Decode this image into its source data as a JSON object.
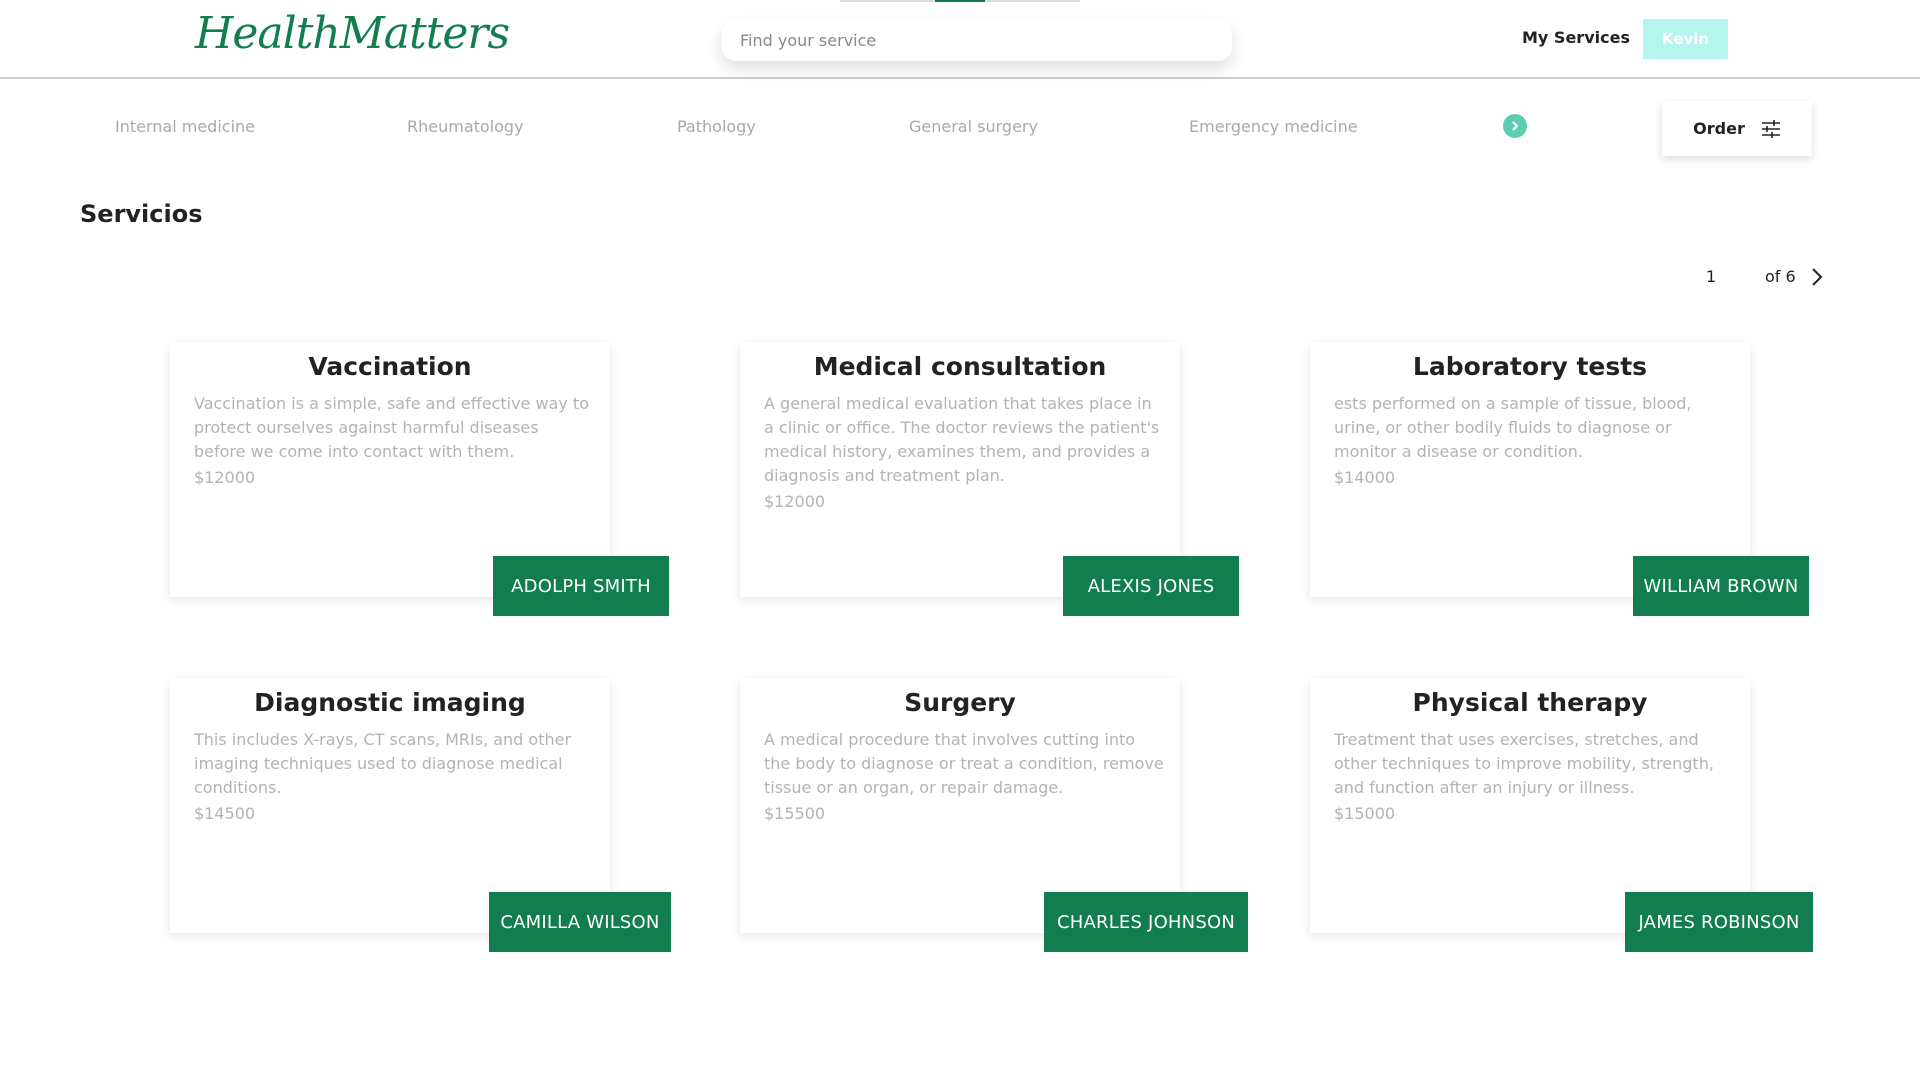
{
  "header": {
    "logo": "HealthMatters",
    "search_placeholder": "Find your service",
    "my_services": "My Services",
    "user": "Kevin"
  },
  "categories": [
    "Internal medicine",
    "Rheumatology",
    "Pathology",
    "General surgery",
    "Emergency medicine"
  ],
  "order_label": "Order",
  "page_title": "Servicios",
  "pagination": {
    "current": "1",
    "of": "of 6"
  },
  "services": [
    {
      "title": "Vaccination",
      "description": "Vaccination is a simple, safe and effective way to protect ourselves against harmful diseases before we come into contact with them.",
      "price": "$12000",
      "doctor": "ADOLPH SMITH"
    },
    {
      "title": "Medical consultation",
      "description": "A general medical evaluation that takes place in a clinic or office. The doctor reviews the patient's medical history, examines them, and provides a diagnosis and treatment plan.",
      "price": "$12000",
      "doctor": "ALEXIS JONES"
    },
    {
      "title": "Laboratory tests",
      "description": "ests performed on a sample of tissue, blood, urine, or other bodily fluids to diagnose or monitor a disease or condition.",
      "price": "$14000",
      "doctor": "WILLIAM BROWN"
    },
    {
      "title": "Diagnostic imaging",
      "description": "This includes X-rays, CT scans, MRIs, and other imaging techniques used to diagnose medical conditions.",
      "price": "$14500",
      "doctor": "CAMILLA WILSON"
    },
    {
      "title": "Surgery",
      "description": "A medical procedure that involves cutting into the body to diagnose or treat a condition, remove tissue or an organ, or repair damage.",
      "price": "$15500",
      "doctor": "CHARLES JOHNSON"
    },
    {
      "title": "Physical therapy",
      "description": "Treatment that uses exercises, stretches, and other techniques to improve mobility, strength, and function after an injury or illness.",
      "price": "$15000",
      "doctor": "JAMES ROBINSON"
    }
  ],
  "colors": {
    "brand": "#127d4f",
    "accent": "#5ccdb0",
    "user_button": "#b6f4ee"
  },
  "icons": {
    "order": "sliders-icon",
    "category_next": "chevron-right-icon",
    "page_next": "chevron-right-icon"
  }
}
